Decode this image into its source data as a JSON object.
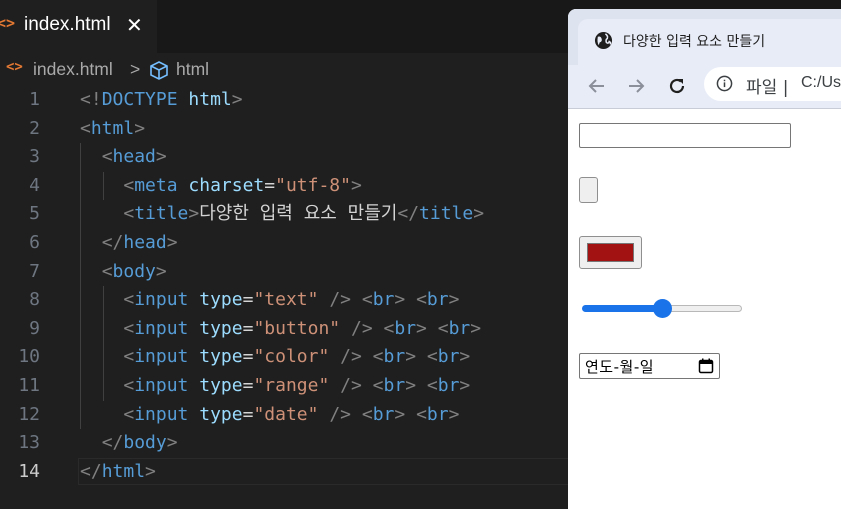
{
  "editor": {
    "tab": {
      "filename": "index.html",
      "close": "✕"
    },
    "breadcrumb": {
      "file": "index.html",
      "separator": ">",
      "element": "html"
    },
    "lines": [
      {
        "n": "1",
        "tokens": [
          [
            "t-punc",
            "<!"
          ],
          [
            "t-kw",
            "DOCTYPE"
          ],
          [
            "t-text",
            " "
          ],
          [
            "t-attr",
            "html"
          ],
          [
            "t-punc",
            ">"
          ]
        ]
      },
      {
        "n": "2",
        "tokens": [
          [
            "t-punc",
            "<"
          ],
          [
            "t-tag",
            "html"
          ],
          [
            "t-punc",
            ">"
          ]
        ]
      },
      {
        "n": "3",
        "tokens": [
          [
            "t-text",
            "  "
          ],
          [
            "t-punc",
            "<"
          ],
          [
            "t-tag",
            "head"
          ],
          [
            "t-punc",
            ">"
          ]
        ]
      },
      {
        "n": "4",
        "tokens": [
          [
            "t-text",
            "    "
          ],
          [
            "t-punc",
            "<"
          ],
          [
            "t-tag",
            "meta"
          ],
          [
            "t-text",
            " "
          ],
          [
            "t-attr",
            "charset"
          ],
          [
            "t-text",
            "="
          ],
          [
            "t-str",
            "\"utf-8\""
          ],
          [
            "t-punc",
            ">"
          ]
        ]
      },
      {
        "n": "5",
        "tokens": [
          [
            "t-text",
            "    "
          ],
          [
            "t-punc",
            "<"
          ],
          [
            "t-tag",
            "title"
          ],
          [
            "t-punc",
            ">"
          ],
          [
            "t-text",
            "다양한 입력 요소 만들기"
          ],
          [
            "t-punc",
            "</"
          ],
          [
            "t-tag",
            "title"
          ],
          [
            "t-punc",
            ">"
          ]
        ]
      },
      {
        "n": "6",
        "tokens": [
          [
            "t-text",
            "  "
          ],
          [
            "t-punc",
            "</"
          ],
          [
            "t-tag",
            "head"
          ],
          [
            "t-punc",
            ">"
          ]
        ]
      },
      {
        "n": "7",
        "tokens": [
          [
            "t-text",
            "  "
          ],
          [
            "t-punc",
            "<"
          ],
          [
            "t-tag",
            "body"
          ],
          [
            "t-punc",
            ">"
          ]
        ]
      },
      {
        "n": "8",
        "tokens": [
          [
            "t-text",
            "    "
          ],
          [
            "t-punc",
            "<"
          ],
          [
            "t-tag",
            "input"
          ],
          [
            "t-text",
            " "
          ],
          [
            "t-attr",
            "type"
          ],
          [
            "t-text",
            "="
          ],
          [
            "t-str",
            "\"text\""
          ],
          [
            "t-text",
            " "
          ],
          [
            "t-punc",
            "/>"
          ],
          [
            "t-text",
            " "
          ],
          [
            "t-punc",
            "<"
          ],
          [
            "t-tag",
            "br"
          ],
          [
            "t-punc",
            ">"
          ],
          [
            "t-text",
            " "
          ],
          [
            "t-punc",
            "<"
          ],
          [
            "t-tag",
            "br"
          ],
          [
            "t-punc",
            ">"
          ]
        ]
      },
      {
        "n": "9",
        "tokens": [
          [
            "t-text",
            "    "
          ],
          [
            "t-punc",
            "<"
          ],
          [
            "t-tag",
            "input"
          ],
          [
            "t-text",
            " "
          ],
          [
            "t-attr",
            "type"
          ],
          [
            "t-text",
            "="
          ],
          [
            "t-str",
            "\"button\""
          ],
          [
            "t-text",
            " "
          ],
          [
            "t-punc",
            "/>"
          ],
          [
            "t-text",
            " "
          ],
          [
            "t-punc",
            "<"
          ],
          [
            "t-tag",
            "br"
          ],
          [
            "t-punc",
            ">"
          ],
          [
            "t-text",
            " "
          ],
          [
            "t-punc",
            "<"
          ],
          [
            "t-tag",
            "br"
          ],
          [
            "t-punc",
            ">"
          ]
        ]
      },
      {
        "n": "10",
        "tokens": [
          [
            "t-text",
            "    "
          ],
          [
            "t-punc",
            "<"
          ],
          [
            "t-tag",
            "input"
          ],
          [
            "t-text",
            " "
          ],
          [
            "t-attr",
            "type"
          ],
          [
            "t-text",
            "="
          ],
          [
            "t-str",
            "\"color\""
          ],
          [
            "t-text",
            " "
          ],
          [
            "t-punc",
            "/>"
          ],
          [
            "t-text",
            " "
          ],
          [
            "t-punc",
            "<"
          ],
          [
            "t-tag",
            "br"
          ],
          [
            "t-punc",
            ">"
          ],
          [
            "t-text",
            " "
          ],
          [
            "t-punc",
            "<"
          ],
          [
            "t-tag",
            "br"
          ],
          [
            "t-punc",
            ">"
          ]
        ]
      },
      {
        "n": "11",
        "tokens": [
          [
            "t-text",
            "    "
          ],
          [
            "t-punc",
            "<"
          ],
          [
            "t-tag",
            "input"
          ],
          [
            "t-text",
            " "
          ],
          [
            "t-attr",
            "type"
          ],
          [
            "t-text",
            "="
          ],
          [
            "t-str",
            "\"range\""
          ],
          [
            "t-text",
            " "
          ],
          [
            "t-punc",
            "/>"
          ],
          [
            "t-text",
            " "
          ],
          [
            "t-punc",
            "<"
          ],
          [
            "t-tag",
            "br"
          ],
          [
            "t-punc",
            ">"
          ],
          [
            "t-text",
            " "
          ],
          [
            "t-punc",
            "<"
          ],
          [
            "t-tag",
            "br"
          ],
          [
            "t-punc",
            ">"
          ]
        ]
      },
      {
        "n": "12",
        "tokens": [
          [
            "t-text",
            "    "
          ],
          [
            "t-punc",
            "<"
          ],
          [
            "t-tag",
            "input"
          ],
          [
            "t-text",
            " "
          ],
          [
            "t-attr",
            "type"
          ],
          [
            "t-text",
            "="
          ],
          [
            "t-str",
            "\"date\""
          ],
          [
            "t-text",
            " "
          ],
          [
            "t-punc",
            "/>"
          ],
          [
            "t-text",
            " "
          ],
          [
            "t-punc",
            "<"
          ],
          [
            "t-tag",
            "br"
          ],
          [
            "t-punc",
            ">"
          ],
          [
            "t-text",
            " "
          ],
          [
            "t-punc",
            "<"
          ],
          [
            "t-tag",
            "br"
          ],
          [
            "t-punc",
            ">"
          ]
        ]
      },
      {
        "n": "13",
        "tokens": [
          [
            "t-text",
            "  "
          ],
          [
            "t-punc",
            "</"
          ],
          [
            "t-tag",
            "body"
          ],
          [
            "t-punc",
            ">"
          ]
        ]
      },
      {
        "n": "14",
        "tokens": [
          [
            "t-punc",
            "</"
          ],
          [
            "t-tag",
            "html"
          ],
          [
            "t-punc",
            ">"
          ]
        ]
      }
    ],
    "current_line": "14"
  },
  "browser": {
    "tab_title": "다양한 입력 요소 만들기",
    "address": {
      "protocol": "파일",
      "separator": "|",
      "path": "C:/Us"
    },
    "inputs": {
      "color_value": "#a31212",
      "range_fraction": 0.5,
      "date_placeholder": "연도-월-일"
    }
  },
  "colors": {
    "accent": "#1a73e8",
    "editor_bg": "#1f1f1f",
    "html_icon": "#e37933"
  }
}
